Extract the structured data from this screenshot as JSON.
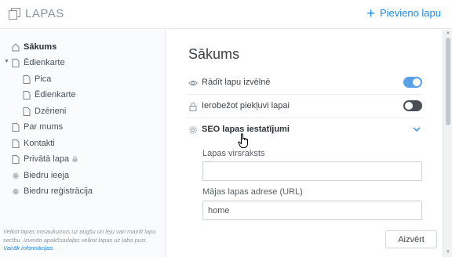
{
  "header": {
    "title": "LAPAS",
    "add_page_label": "Pievieno lapu",
    "add_page_icon": "plus-icon",
    "logo_icon": "pages-stack-icon",
    "accent_color": "#1a88e8"
  },
  "sidebar": {
    "items": [
      {
        "label": "Sākums",
        "icon": "home-icon",
        "active": true
      },
      {
        "label": "Ēdienkarte",
        "icon": "page-icon",
        "expanded": true
      },
      {
        "label": "Pica",
        "icon": "page-icon"
      },
      {
        "label": "Ēdienkarte",
        "icon": "page-icon"
      },
      {
        "label": "Dzērieni",
        "icon": "page-icon"
      },
      {
        "label": "Par mums",
        "icon": "page-icon"
      },
      {
        "label": "Kontakti",
        "icon": "page-icon"
      },
      {
        "label": "Privātā lapa",
        "icon": "page-icon",
        "locked": true
      },
      {
        "label": "Biedru ieeja",
        "icon": "gear-icon"
      },
      {
        "label": "Biedru reģistrācija",
        "icon": "gear-icon"
      }
    ],
    "note_text": "Velkot lapas nosaukumus uz augšu un leju vari mainīt lapu secību. Izveido apakšsadaļas velkot lapas uz labo pusi.",
    "note_link": "Vairāk informācijas."
  },
  "main": {
    "page_title": "Sākums",
    "rows": [
      {
        "label": "Rādīt lapu izvēlnē",
        "icon": "eye-icon",
        "toggle": true
      },
      {
        "label": "Ierobežot piekļuvi lapai",
        "icon": "lock-icon",
        "toggle": false
      },
      {
        "label": "SEO lapas iestatījumi",
        "icon": "gear-icon",
        "expanded": true
      }
    ],
    "seo": {
      "page_title_label": "Lapas virsraksts",
      "page_title_value": "",
      "url_label": "Mājas lapas adrese (URL)",
      "url_placeholder": "home"
    },
    "close_label": "Aizvērt",
    "toggle_on_color": "#5aa0e4",
    "toggle_off_color": "#4a4f56"
  }
}
